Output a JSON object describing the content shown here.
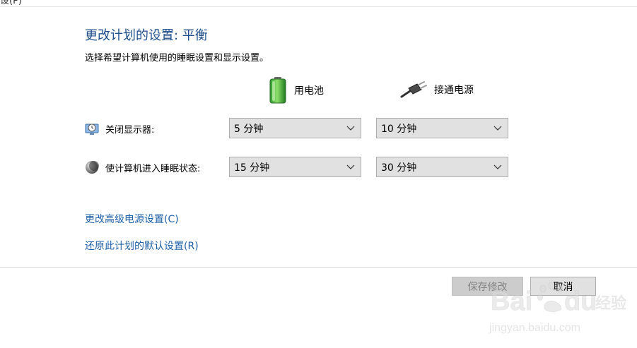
{
  "header": {
    "fragment_text": "设(P)",
    "title": "更改计划的设置: 平衡",
    "subtitle": "选择希望计算机使用的睡眠设置和显示设置。"
  },
  "columns": {
    "battery": {
      "label": "用电池",
      "icon": "battery-icon"
    },
    "plugged": {
      "label": "接通电源",
      "icon": "power-plug-icon"
    }
  },
  "rows": [
    {
      "label": "关闭显示器:",
      "icon": "display-clock-icon",
      "battery_value": "5 分钟",
      "plugged_value": "10 分钟"
    },
    {
      "label": "使计算机进入睡眠状态:",
      "icon": "moon-icon",
      "battery_value": "15 分钟",
      "plugged_value": "30 分钟"
    }
  ],
  "links": {
    "advanced": "更改高级电源设置(C)",
    "restore": "还原此计划的默认设置(R)"
  },
  "buttons": {
    "save": "保存修改",
    "cancel": "取消"
  },
  "watermark": {
    "brand": "Baidu",
    "cn_text": "经验",
    "url": "jingyan.baidu.com"
  },
  "colors": {
    "title": "#1e4e8c",
    "link": "#1d5fa8",
    "dropdown_bg": "#e1e1e1",
    "disabled_text": "#838383"
  }
}
